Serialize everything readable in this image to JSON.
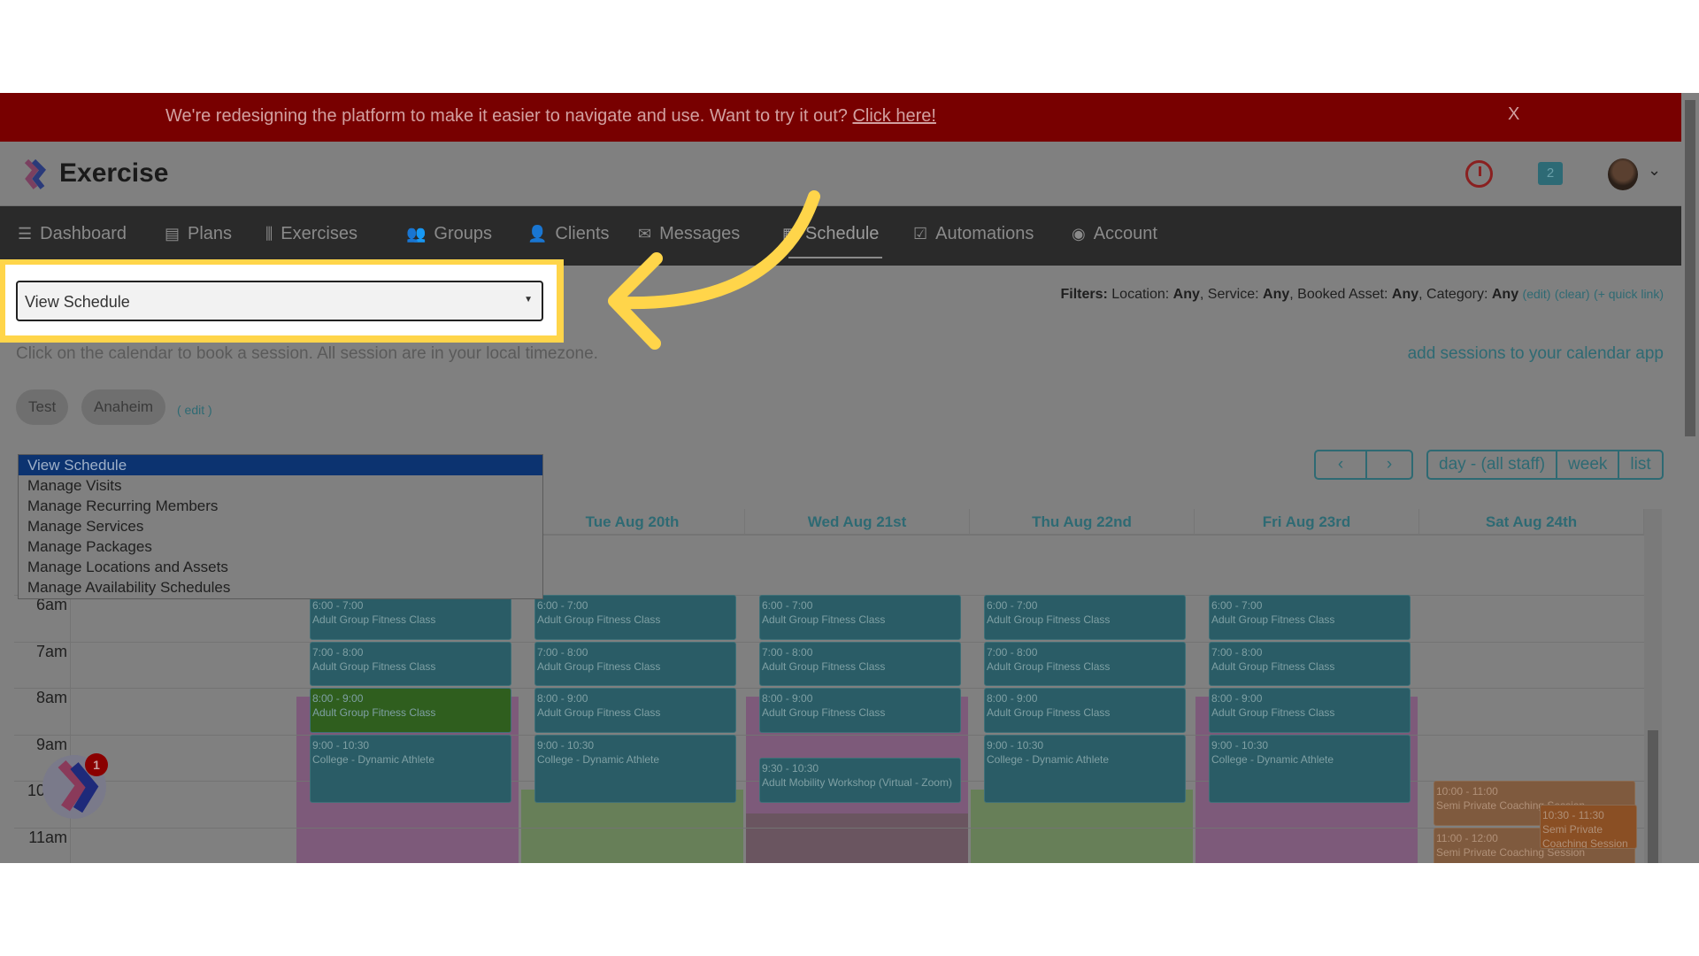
{
  "banner": {
    "text": "We're redesigning the platform to make it easier to navigate and use. Want to try it out?",
    "link": "Click here!",
    "close": "X"
  },
  "header": {
    "brand": "Exercise",
    "notification_count": "2"
  },
  "nav": [
    {
      "label": "Dashboard",
      "icon": "list-icon",
      "glyph": "☰"
    },
    {
      "label": "Plans",
      "icon": "clipboard-icon",
      "glyph": "▤"
    },
    {
      "label": "Exercises",
      "icon": "dumbbell-icon",
      "glyph": "⫼"
    },
    {
      "label": "Groups",
      "icon": "users-icon",
      "glyph": "👥"
    },
    {
      "label": "Clients",
      "icon": "user-icon",
      "glyph": "👤"
    },
    {
      "label": "Messages",
      "icon": "envelope-icon",
      "glyph": "✉"
    },
    {
      "label": "Schedule",
      "icon": "calendar-icon",
      "glyph": "▦",
      "active": true
    },
    {
      "label": "Automations",
      "icon": "check-square-icon",
      "glyph": "☑"
    },
    {
      "label": "Account",
      "icon": "user-circle-icon",
      "glyph": "◉"
    }
  ],
  "select": {
    "value": "View Schedule",
    "options": [
      "View Schedule",
      "Manage Visits",
      "Manage Recurring Members",
      "Manage Services",
      "Manage Packages",
      "Manage Locations and Assets",
      "Manage Availability Schedules"
    ]
  },
  "filters": {
    "label": "Filters:",
    "location_label": "Location:",
    "location": "Any",
    "service_label": "Service:",
    "service": "Any",
    "asset_label": "Booked Asset:",
    "asset": "Any",
    "category_label": "Category:",
    "category": "Any",
    "edit": "(edit)",
    "clear": "(clear)",
    "quick": "(+ quick link)"
  },
  "info": "Click on the calendar to book a session. All session are in your local timezone.",
  "calendar_link": "add sessions to your calendar app",
  "tags": [
    "Test",
    "Anaheim"
  ],
  "tags_edit": "( edit )",
  "view_buttons": [
    "day - (all staff)",
    "week",
    "list"
  ],
  "days": [
    "",
    "",
    "Tue Aug 20th",
    "Wed Aug 21st",
    "Thu Aug 22nd",
    "Fri Aug 23rd",
    "Sat Aug 24th"
  ],
  "hours": [
    "6am",
    "7am",
    "8am",
    "9am",
    "10am",
    "11am"
  ],
  "colors": {
    "teal": "#2a5c66",
    "green": "#2f5e1e",
    "orange": "#7f5a3e",
    "orange_dark": "#8a4f24"
  },
  "availability": [
    {
      "day": 1,
      "start": 8,
      "end": 12,
      "color": "#7d5a7a"
    },
    {
      "day": 2,
      "start": 10,
      "end": 12,
      "color": "#677f58"
    },
    {
      "day": 3,
      "start": 8,
      "end": 10.5,
      "color": "#7d5a7a"
    },
    {
      "day": 3,
      "start": 10.5,
      "end": 12,
      "color": "#6a5560"
    },
    {
      "day": 4,
      "start": 10,
      "end": 12,
      "color": "#677f58"
    },
    {
      "day": 5,
      "start": 8,
      "end": 12,
      "color": "#7d5a7a"
    }
  ],
  "events": [
    {
      "day": 1,
      "start": 6,
      "end": 7,
      "time": "6:00 - 7:00",
      "title": "Adult Group Fitness Class",
      "color": "teal"
    },
    {
      "day": 1,
      "start": 7,
      "end": 8,
      "time": "7:00 - 8:00",
      "title": "Adult Group Fitness Class",
      "color": "teal"
    },
    {
      "day": 1,
      "start": 8,
      "end": 9,
      "time": "8:00 - 9:00",
      "title": "Adult Group Fitness Class",
      "color": "green"
    },
    {
      "day": 1,
      "start": 9,
      "end": 10.5,
      "time": "9:00 - 10:30",
      "title": "College - Dynamic Athlete",
      "color": "teal"
    },
    {
      "day": 2,
      "start": 6,
      "end": 7,
      "time": "6:00 - 7:00",
      "title": "Adult Group Fitness Class",
      "color": "teal"
    },
    {
      "day": 2,
      "start": 7,
      "end": 8,
      "time": "7:00 - 8:00",
      "title": "Adult Group Fitness Class",
      "color": "teal"
    },
    {
      "day": 2,
      "start": 8,
      "end": 9,
      "time": "8:00 - 9:00",
      "title": "Adult Group Fitness Class",
      "color": "teal"
    },
    {
      "day": 2,
      "start": 9,
      "end": 10.5,
      "time": "9:00 - 10:30",
      "title": "College - Dynamic Athlete",
      "color": "teal"
    },
    {
      "day": 3,
      "start": 6,
      "end": 7,
      "time": "6:00 - 7:00",
      "title": "Adult Group Fitness Class",
      "color": "teal"
    },
    {
      "day": 3,
      "start": 7,
      "end": 8,
      "time": "7:00 - 8:00",
      "title": "Adult Group Fitness Class",
      "color": "teal"
    },
    {
      "day": 3,
      "start": 8,
      "end": 9,
      "time": "8:00 - 9:00",
      "title": "Adult Group Fitness Class",
      "color": "teal"
    },
    {
      "day": 3,
      "start": 9.5,
      "end": 10.5,
      "time": "9:30 - 10:30",
      "title": "Adult Mobility Workshop (Virtual - Zoom)",
      "color": "teal"
    },
    {
      "day": 4,
      "start": 6,
      "end": 7,
      "time": "6:00 - 7:00",
      "title": "Adult Group Fitness Class",
      "color": "teal"
    },
    {
      "day": 4,
      "start": 7,
      "end": 8,
      "time": "7:00 - 8:00",
      "title": "Adult Group Fitness Class",
      "color": "teal"
    },
    {
      "day": 4,
      "start": 8,
      "end": 9,
      "time": "8:00 - 9:00",
      "title": "Adult Group Fitness Class",
      "color": "teal"
    },
    {
      "day": 4,
      "start": 9,
      "end": 10.5,
      "time": "9:00 - 10:30",
      "title": "College - Dynamic Athlete",
      "color": "teal"
    },
    {
      "day": 5,
      "start": 6,
      "end": 7,
      "time": "6:00 - 7:00",
      "title": "Adult Group Fitness Class",
      "color": "teal"
    },
    {
      "day": 5,
      "start": 7,
      "end": 8,
      "time": "7:00 - 8:00",
      "title": "Adult Group Fitness Class",
      "color": "teal"
    },
    {
      "day": 5,
      "start": 8,
      "end": 9,
      "time": "8:00 - 9:00",
      "title": "Adult Group Fitness Class",
      "color": "teal"
    },
    {
      "day": 5,
      "start": 9,
      "end": 10.5,
      "time": "9:00 - 10:30",
      "title": "College - Dynamic Athlete",
      "color": "teal"
    },
    {
      "day": 6,
      "start": 10,
      "end": 11,
      "time": "10:00 - 11:00",
      "title": "Semi Private Coaching Session",
      "color": "orange"
    },
    {
      "day": 6,
      "start": 11,
      "end": 12,
      "time": "11:00 - 12:00",
      "title": "Semi Private Coaching Session",
      "color": "orange"
    },
    {
      "day": 6,
      "start": 10.5,
      "end": 11.5,
      "time": "10:30 - 11:30",
      "title": "Semi Private Coaching Session",
      "color": "orange_dark",
      "half": true
    }
  ],
  "chat_badge": "1"
}
